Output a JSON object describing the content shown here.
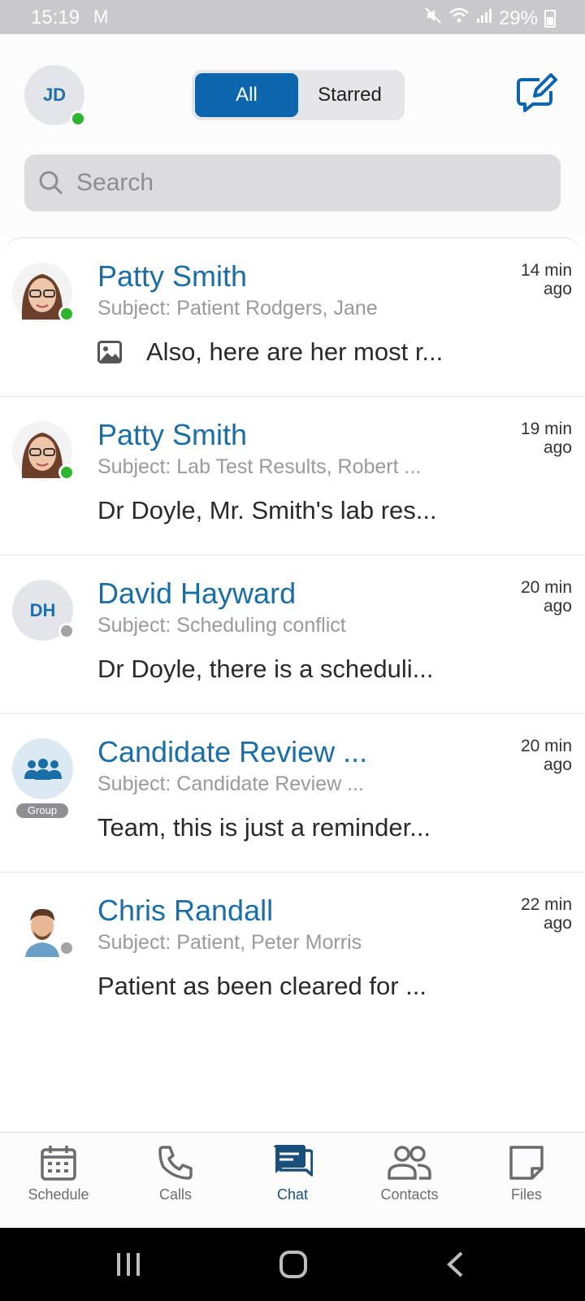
{
  "status": {
    "time": "15:19",
    "mail": "M",
    "battery": "29%"
  },
  "header": {
    "me_initials": "JD",
    "segments": [
      {
        "label": "All",
        "active": true
      },
      {
        "label": "Starred",
        "active": false
      }
    ],
    "search_placeholder": "Search"
  },
  "chats": [
    {
      "name": "Patty Smith",
      "subject": "Subject: Patient Rodgers, Jane",
      "preview": "Also, here are her most r...",
      "time": "14 min ago",
      "presence": "online",
      "has_image": true
    },
    {
      "name": "Patty Smith",
      "subject": "Subject: Lab Test Results, Robert ...",
      "preview": "Dr Doyle, Mr. Smith's lab res...",
      "time": "19 min ago",
      "presence": "online"
    },
    {
      "name": "David Hayward",
      "initials": "DH",
      "subject": "Subject: Scheduling conflict",
      "preview": "Dr Doyle, there is a scheduli...",
      "time": "20 min ago",
      "presence": "offline"
    },
    {
      "name": "Candidate Review ...",
      "badge": "Group",
      "subject": "Subject: Candidate Review ...",
      "preview": "Team, this is just a reminder...",
      "time": "20 min ago"
    },
    {
      "name": "Chris Randall",
      "subject": "Subject: Patient, Peter Morris",
      "preview": "Patient as been cleared for ...",
      "time": "22 min ago",
      "presence": "offline"
    }
  ],
  "tabs": [
    {
      "label": "Schedule",
      "icon": "calendar-icon"
    },
    {
      "label": "Calls",
      "icon": "phone-icon"
    },
    {
      "label": "Chat",
      "icon": "chat-icon",
      "active": true
    },
    {
      "label": "Contacts",
      "icon": "contacts-icon"
    },
    {
      "label": "Files",
      "icon": "file-icon"
    }
  ],
  "colors": {
    "accent": "#0d66ad",
    "name_blue": "#1a6ea6",
    "online": "#2db52d",
    "offline": "#a3a3a3"
  }
}
